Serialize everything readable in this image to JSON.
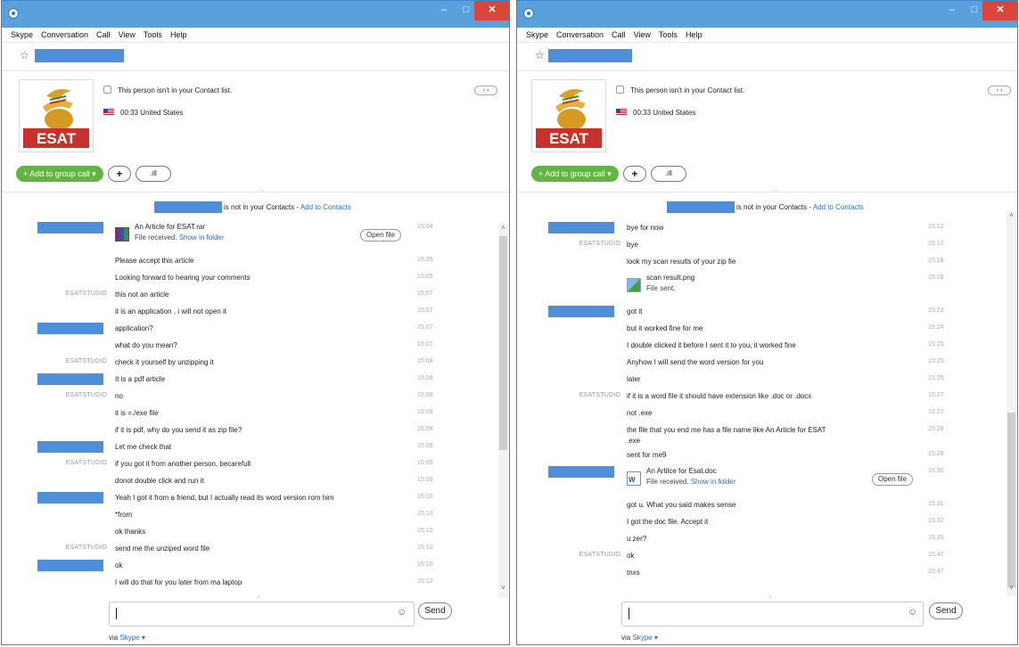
{
  "menu": [
    "Skype",
    "Conversation",
    "Call",
    "View",
    "Tools",
    "Help"
  ],
  "window_buttons": {
    "minimize": "–",
    "maximize": "□",
    "close": "✕"
  },
  "profile": {
    "avatar_text": "ESAT",
    "contact_notice": "This person isn't in your Contact list.",
    "local_time": "00:33 United States",
    "nav": "‹ ›"
  },
  "call_bar": {
    "add_to_group_call": "+ Add to group call ▾",
    "add": "+",
    "call_quality": ".ıll"
  },
  "contact_notice": {
    "text": "is not in your Contacts - ",
    "link": "Add to Contacts"
  },
  "input": {
    "emoticon": "☺",
    "send": "Send"
  },
  "via": {
    "prefix": "via ",
    "link": "Skype ▾"
  },
  "grip": "∙∙∙",
  "windows": [
    {
      "messages": [
        {
          "sender": "blurred",
          "type": "file",
          "file_icon": "rar",
          "text": "An Article for ESAT.rar",
          "sub_text": "File received.",
          "sub_link": "Show in folder",
          "action": "Open file",
          "time": "15:04"
        },
        {
          "sender": "",
          "text": "Please accept this article",
          "time": "15:05"
        },
        {
          "sender": "",
          "text": "Looking forward to hearing your comments",
          "time": "15:05"
        },
        {
          "sender": "ESATSTUDIO",
          "text": "this not an article",
          "time": "15:07"
        },
        {
          "sender": "",
          "text": "it is an application , i will not open it",
          "time": "15:07"
        },
        {
          "sender": "blurred",
          "text": "application?",
          "time": "15:07"
        },
        {
          "sender": "",
          "text": "what do you mean?",
          "time": "15:07"
        },
        {
          "sender": "ESATSTUDIO",
          "text": "check it yourself by unzipping it",
          "time": "15:08"
        },
        {
          "sender": "blurred",
          "text": "It is a pdf article",
          "time": "15:08"
        },
        {
          "sender": "ESATSTUDIO",
          "text": "no",
          "time": "15:08"
        },
        {
          "sender": "",
          "text": "it is =./exe file",
          "time": "15:08"
        },
        {
          "sender": "",
          "text": "if it is pdf, why do you send it as zip file?",
          "time": "15:08"
        },
        {
          "sender": "blurred",
          "text": "Let me check that",
          "time": "15:09"
        },
        {
          "sender": "ESATSTUDIO",
          "text": "if you got it from another person, becarefull",
          "time": "15:09"
        },
        {
          "sender": "",
          "text": "donot double click and run it",
          "time": "15:09"
        },
        {
          "sender": "blurred",
          "text": "Yeah I got it from a friend, but I actually read its word version rom him",
          "time": "15:10"
        },
        {
          "sender": "",
          "text": "*from",
          "time": "15:10"
        },
        {
          "sender": "",
          "text": "ok thanks",
          "time": "15:10"
        },
        {
          "sender": "ESATSTUDIO",
          "text": "send me the unziped word file",
          "time": "15:10"
        },
        {
          "sender": "blurred",
          "text": "ok",
          "time": "15:10"
        },
        {
          "sender": "",
          "text": "I will do that for you later from ma laptop",
          "time": "15:12"
        }
      ]
    },
    {
      "messages": [
        {
          "sender": "blurred",
          "text": "bye for now",
          "time": "15:12"
        },
        {
          "sender": "ESATSTUDIO",
          "text": "bye",
          "time": "15:12"
        },
        {
          "sender": "",
          "text": "look my scan results of your zip fie",
          "time": "15:18"
        },
        {
          "sender": "",
          "type": "file",
          "file_icon": "png",
          "text": "scan result.png",
          "sub_text": "File sent.",
          "sub_link": "",
          "action": "",
          "time": "15:18"
        },
        {
          "sender": "blurred",
          "text": "got it",
          "time": "15:23"
        },
        {
          "sender": "",
          "text": "but it worked fine for me",
          "time": "15:24"
        },
        {
          "sender": "",
          "text": "I double clicked it before I sent it to you, it worked fine",
          "time": "15:25"
        },
        {
          "sender": "",
          "text": "Anyhow I will send the word version for you",
          "time": "15:25"
        },
        {
          "sender": "",
          "text": "later",
          "time": "15:25"
        },
        {
          "sender": "ESATSTUDIO",
          "text": "if it is a word file it should have extension like .doc or .docx",
          "time": "15:27"
        },
        {
          "sender": "",
          "text": "not .exe",
          "time": "15:27"
        },
        {
          "sender": "",
          "text": "the file that you end me has a file name like An Article for ESAT",
          "text2": ".exe",
          "time": "15:28"
        },
        {
          "sender": "",
          "text": "sent for me9",
          "time": "15:28"
        },
        {
          "sender": "blurred",
          "type": "file",
          "file_icon": "doc",
          "text": "An Artilce for Esat.doc",
          "sub_text": "File received.",
          "sub_link": "Show in folder",
          "action": "Open file",
          "time": "15:30"
        },
        {
          "sender": "",
          "text": "got u. What you said makes sense",
          "time": "15:31"
        },
        {
          "sender": "",
          "text": "I got the doc file. Accept it",
          "time": "15:32"
        },
        {
          "sender": "",
          "text": "u zer?",
          "time": "15:35"
        },
        {
          "sender": "ESATSTUDIO",
          "text": "ok",
          "time": "15:47"
        },
        {
          "sender": "",
          "text": "tnxs",
          "time": "15:47"
        }
      ]
    }
  ]
}
